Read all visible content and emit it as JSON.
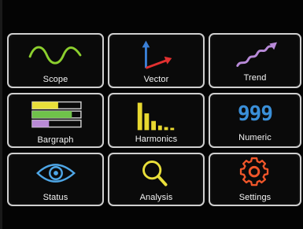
{
  "tiles": [
    {
      "label": "Scope",
      "icon": "sine-wave-icon"
    },
    {
      "label": "Vector",
      "icon": "vector-axes-icon"
    },
    {
      "label": "Trend",
      "icon": "trend-wave-arrow-icon"
    },
    {
      "label": "Bargraph",
      "icon": "bargraph-icon"
    },
    {
      "label": "Harmonics",
      "icon": "harmonics-bars-icon"
    },
    {
      "label": "Numeric",
      "icon": "numeric-digits-icon",
      "digits": "999"
    },
    {
      "label": "Status",
      "icon": "eye-icon"
    },
    {
      "label": "Analysis",
      "icon": "magnifier-icon"
    },
    {
      "label": "Settings",
      "icon": "gear-icon"
    }
  ],
  "colors": {
    "screen_bg": "#040404",
    "tile_border": "#cfcfcf",
    "scope_wave": "#8ccf2e",
    "vector_blue": "#3a7fd6",
    "vector_red": "#e23030",
    "trend_purple": "#b88ad8",
    "bar_yellow": "#e8df3a",
    "bar_green": "#6fc24a",
    "bar_purple": "#b98ad6",
    "harmonic_yellow": "#e8d830",
    "numeric_blue": "#3a8fd8",
    "eye_blue": "#4ea6e6",
    "magnifier_yellow": "#e9df3a",
    "gear_orange": "#f0562a"
  }
}
